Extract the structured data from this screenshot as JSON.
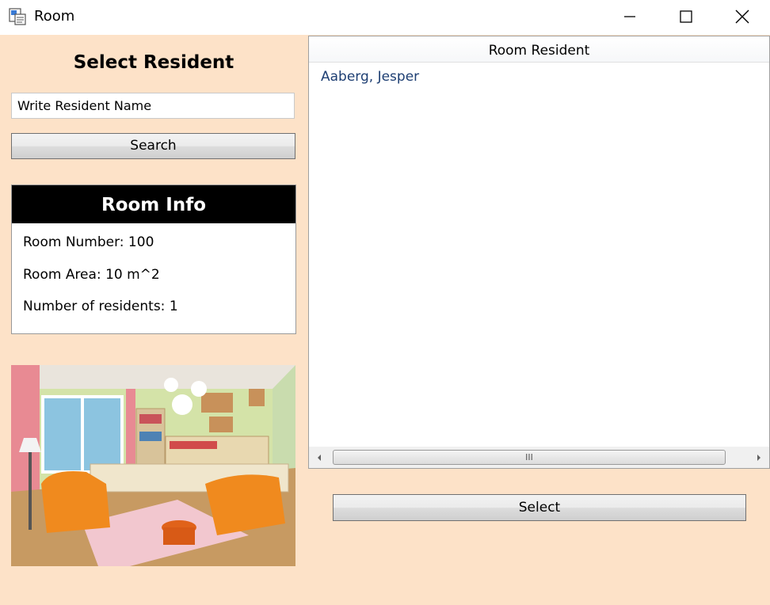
{
  "window": {
    "title": "Room"
  },
  "left_panel": {
    "heading": "Select Resident",
    "search_input": {
      "value": "Write Resident Name",
      "placeholder": "Write Resident Name"
    },
    "search_button": "Search",
    "room_info": {
      "title": "Room Info",
      "room_number": "Room Number: 100",
      "room_area": "Room Area: 10 m^2",
      "residents": "Number of residents: 1"
    }
  },
  "resident_list": {
    "column_header": "Room Resident",
    "rows": [
      "Aaberg, Jesper"
    ],
    "scroll_grip": "III"
  },
  "select_button": "Select",
  "colors": {
    "background": "#fde2c8",
    "info_header": "#000000",
    "list_text": "#1e3f73"
  }
}
